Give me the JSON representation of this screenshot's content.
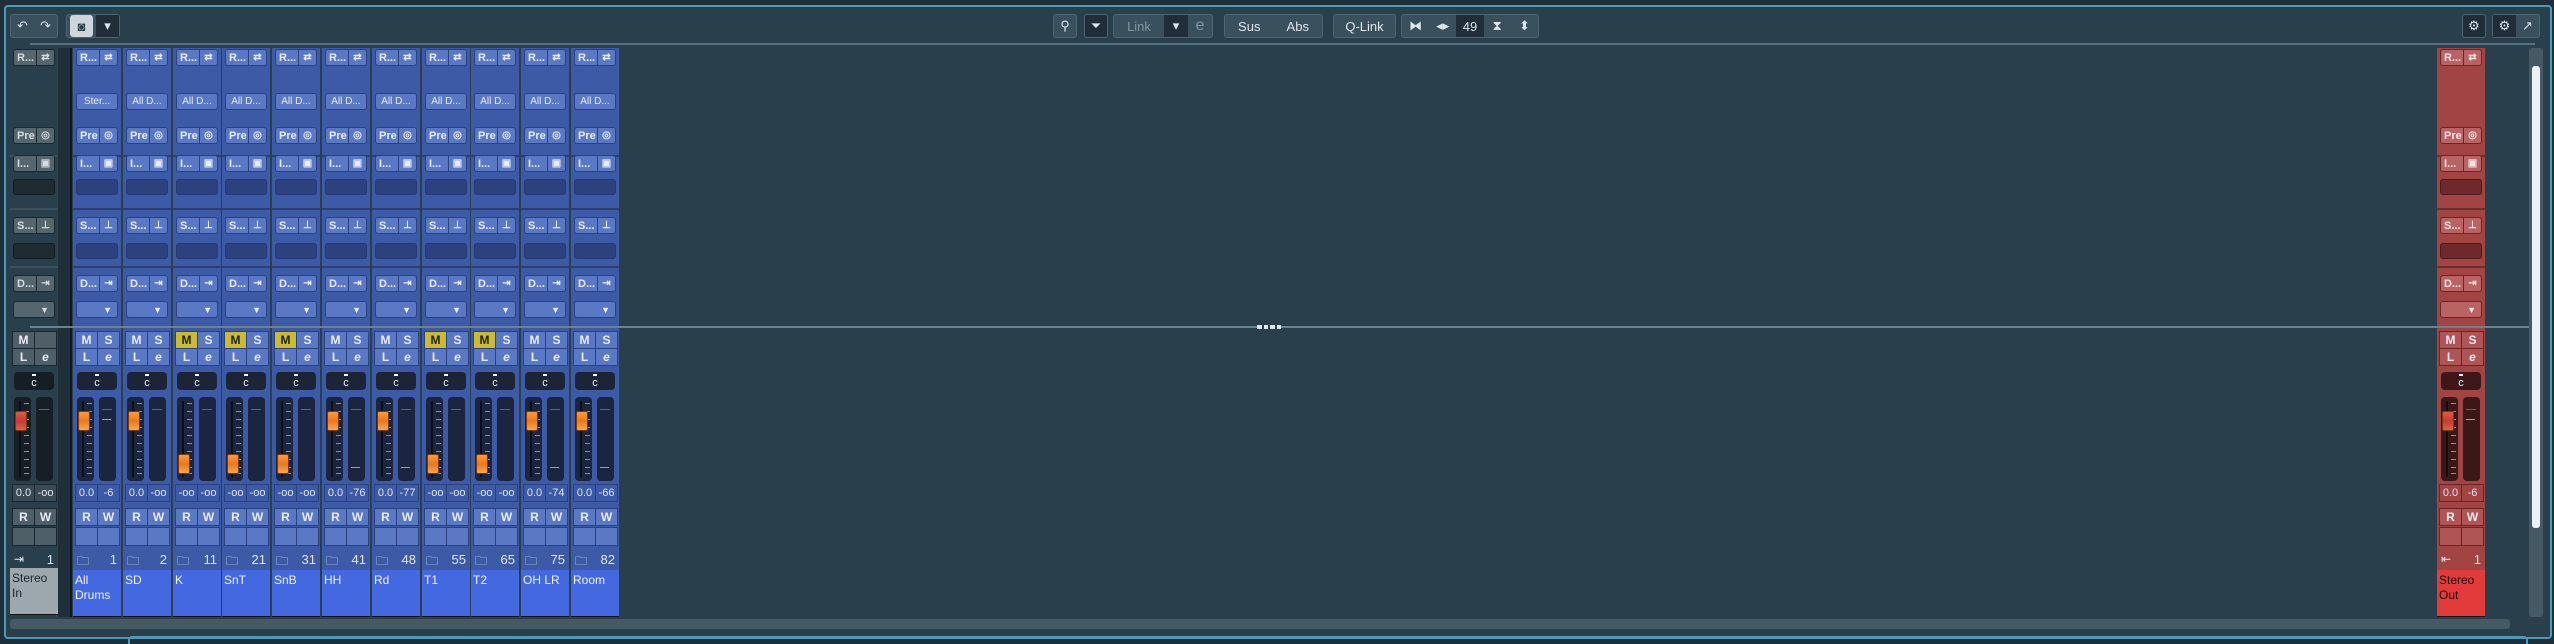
{
  "toolbar": {
    "undo_icon": "undo-icon",
    "redo_icon": "redo-icon",
    "snapshot_icon": "camera-icon",
    "link_label": "Link",
    "sus_label": "Sus",
    "abs_label": "Abs",
    "qlink_label": "Q-Link",
    "channel_width_value": "49"
  },
  "colors": {
    "channel": "#3c5aa6",
    "name_field": "#4468e0",
    "mute_active": "#cbbb32",
    "stereo_out": "#a24344",
    "stereo_out_name": "#e33b3b"
  },
  "labels": {
    "routing": "R...",
    "pre": "Pre",
    "inserts": "I...",
    "sends": "S...",
    "direct": "D...",
    "mute": "M",
    "solo": "S",
    "listen": "L",
    "edit": "e",
    "pan": "c",
    "read": "R",
    "write": "W"
  },
  "stereo_in": {
    "name": "Stereo In",
    "number": "1",
    "fader": "0.0",
    "meter": "-oo"
  },
  "channels": [
    {
      "name": "All Drums",
      "number": "1",
      "input": "Ster...",
      "mute": false,
      "fader": "0.0",
      "meter": "-6",
      "icon": "folder-open-icon"
    },
    {
      "name": "SD",
      "number": "2",
      "input": "All D...",
      "mute": false,
      "fader": "0.0",
      "meter": "-oo",
      "icon": "folder-icon"
    },
    {
      "name": "K",
      "number": "11",
      "input": "All D...",
      "mute": true,
      "fader": "-oo",
      "meter": "-oo",
      "icon": "folder-icon"
    },
    {
      "name": "SnT",
      "number": "21",
      "input": "All D...",
      "mute": true,
      "fader": "-oo",
      "meter": "-oo",
      "icon": "folder-icon"
    },
    {
      "name": "SnB",
      "number": "31",
      "input": "All D...",
      "mute": true,
      "fader": "-oo",
      "meter": "-oo",
      "icon": "folder-icon"
    },
    {
      "name": "HH",
      "number": "41",
      "input": "All D...",
      "mute": false,
      "fader": "0.0",
      "meter": "-76",
      "icon": "folder-icon"
    },
    {
      "name": "Rd",
      "number": "48",
      "input": "All D...",
      "mute": false,
      "fader": "0.0",
      "meter": "-77",
      "icon": "folder-icon"
    },
    {
      "name": "T1",
      "number": "55",
      "input": "All D...",
      "mute": true,
      "fader": "-oo",
      "meter": "-oo",
      "icon": "folder-icon"
    },
    {
      "name": "T2",
      "number": "65",
      "input": "All D...",
      "mute": true,
      "fader": "-oo",
      "meter": "-oo",
      "icon": "folder-icon"
    },
    {
      "name": "OH LR",
      "number": "75",
      "input": "All D...",
      "mute": false,
      "fader": "0.0",
      "meter": "-74",
      "icon": "folder-icon"
    },
    {
      "name": "Room",
      "number": "82",
      "input": "All D...",
      "mute": false,
      "fader": "0.0",
      "meter": "-66",
      "icon": "folder-icon"
    }
  ],
  "stereo_out": {
    "name": "Stereo Out",
    "number": "1",
    "fader": "0.0",
    "meter": "-6"
  }
}
